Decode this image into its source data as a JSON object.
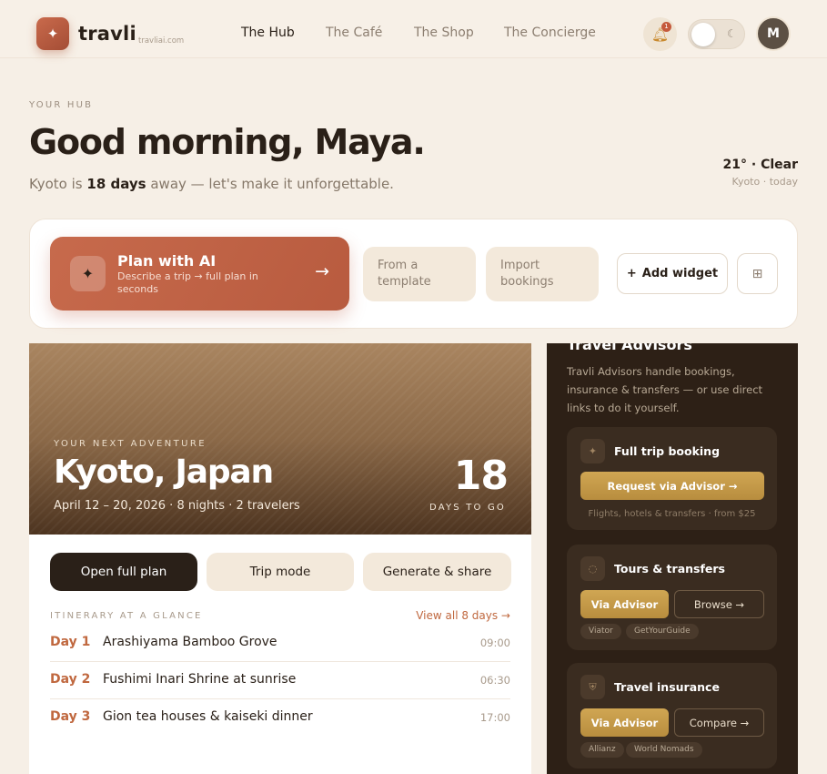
{
  "brand": {
    "name": "travli",
    "domain": "travliai.com",
    "icon": "sparkle-icon"
  },
  "nav": {
    "items": [
      {
        "label": "The Hub",
        "active": true
      },
      {
        "label": "The Café",
        "active": false
      },
      {
        "label": "The Shop",
        "active": false
      },
      {
        "label": "The Concierge",
        "active": false
      }
    ]
  },
  "header": {
    "notification_count": "1",
    "avatar_initial": "M",
    "theme_icon": "moon-icon"
  },
  "hub": {
    "eyebrow": "YOUR HUB",
    "greeting": "Good morning, Maya.",
    "sub_prefix": "Kyoto is ",
    "sub_days": "18 days",
    "sub_suffix": " away — let's make it unforgettable.",
    "weather_main": "21° · Clear",
    "weather_sub": "Kyoto · today"
  },
  "actions": {
    "plan_title": "Plan with AI",
    "plan_desc": "Describe a trip → full plan in seconds",
    "plan_arrow": "→",
    "template_label": "From a template",
    "import_label": "Import bookings",
    "add_widget_label": "Add widget",
    "add_widget_icon": "+",
    "grid_icon": "⊞"
  },
  "trip": {
    "eyebrow": "YOUR NEXT ADVENTURE",
    "destination": "Kyoto, Japan",
    "meta": "April 12 – 20, 2026 · 8 nights · 2 travelers",
    "days_count": "18",
    "days_label": "DAYS TO GO",
    "buttons": {
      "open": "Open full plan",
      "mode": "Trip mode",
      "share": "Generate & share"
    },
    "itinerary_label": "ITINERARY AT A GLANCE",
    "view_all": "View all 8 days →",
    "days": [
      {
        "day": "Day 1",
        "name": "Arashiyama Bamboo Grove",
        "time": "09:00"
      },
      {
        "day": "Day 2",
        "name": "Fushimi Inari Shrine at sunrise",
        "time": "06:30"
      },
      {
        "day": "Day 3",
        "name": "Gion tea houses & kaiseki dinner",
        "time": "17:00"
      }
    ]
  },
  "advisor": {
    "title": "Travel Advisors",
    "desc": "Travli Advisors handle bookings, insurance & transfers — or use direct links to do it yourself.",
    "cards": [
      {
        "name": "Full trip booking",
        "cta": "Request via Advisor →",
        "note": "Flights, hotels & transfers · from $25"
      },
      {
        "name": "Tours & transfers",
        "cta": "Via Advisor",
        "secondary": "Browse →",
        "chips": [
          "Viator",
          "GetYourGuide"
        ]
      },
      {
        "name": "Travel insurance",
        "cta": "Via Advisor",
        "secondary": "Compare →",
        "chips": [
          "Allianz",
          "World Nomads"
        ]
      }
    ]
  }
}
